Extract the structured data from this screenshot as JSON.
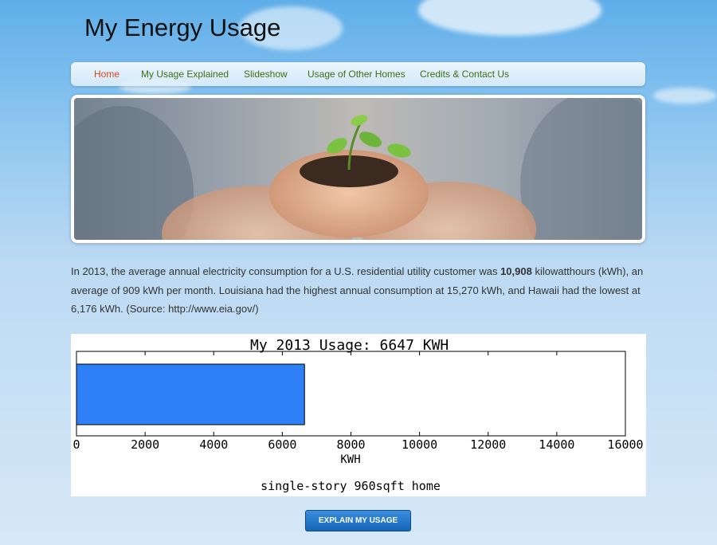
{
  "site": {
    "title": "My Energy Usage"
  },
  "nav": {
    "items": [
      {
        "label": "Home",
        "active": true
      },
      {
        "label": "My Usage Explained",
        "active": false
      },
      {
        "label": "Slideshow",
        "active": false
      },
      {
        "label": "Usage of Other Homes",
        "active": false
      },
      {
        "label": "Credits & Contact Us",
        "active": false
      }
    ]
  },
  "intro": {
    "text_before": "In 2013, the average annual electricity consumption for a U.S. residential utility customer was ",
    "highlight": "10,908",
    "text_after": " kilowatthours (kWh), an average of 909 kWh per month. Louisiana had the highest annual consumption at 15,270 kWh, and Hawaii had the lowest at 6,176 kWh. (Source: http://www.eia.gov/)"
  },
  "chart_data": {
    "type": "bar",
    "orientation": "horizontal",
    "title": "My 2013 Usage: 6647 KWH",
    "xlabel": "KWH",
    "ylabel": "",
    "categories": [
      ""
    ],
    "values": [
      6647
    ],
    "xlim": [
      0,
      16000
    ],
    "xticks": [
      "0",
      "2000",
      "4000",
      "6000",
      "8000",
      "10000",
      "12000",
      "14000",
      "16000"
    ],
    "caption": "single-story 960sqft home",
    "bar_color": "#2f7ff7",
    "grid": false
  },
  "actions": {
    "explain_label": "EXPLAIN MY USAGE"
  }
}
